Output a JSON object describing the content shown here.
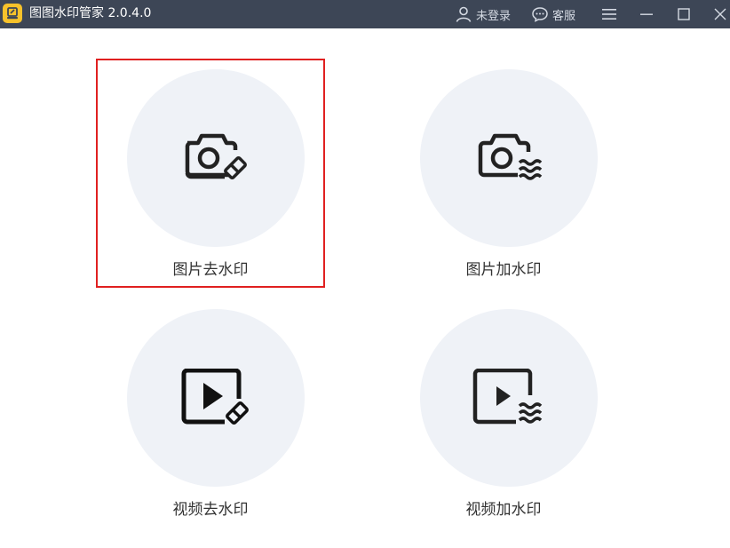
{
  "app": {
    "title": "图图水印管家  2.0.4.0",
    "logo_icon": "stamp-logo-icon",
    "colors": {
      "titlebar": "#3d4656",
      "logo": "#f7c22b",
      "card_bg": "#eff2f7",
      "selected_border": "#e02020",
      "icon": "#222222"
    }
  },
  "titlebar": {
    "login_label": "未登录",
    "service_label": "客服",
    "menu_icon": "hamburger-menu-icon",
    "minimize_icon": "minimize-icon",
    "maximize_icon": "maximize-icon",
    "close_icon": "close-icon"
  },
  "features": [
    {
      "label": "图片去水印",
      "icon": "camera-eraser-icon",
      "selected": true
    },
    {
      "label": "图片加水印",
      "icon": "camera-watermark-icon",
      "selected": false
    },
    {
      "label": "视频去水印",
      "icon": "video-eraser-icon",
      "selected": false
    },
    {
      "label": "视频加水印",
      "icon": "video-watermark-icon",
      "selected": false
    }
  ]
}
